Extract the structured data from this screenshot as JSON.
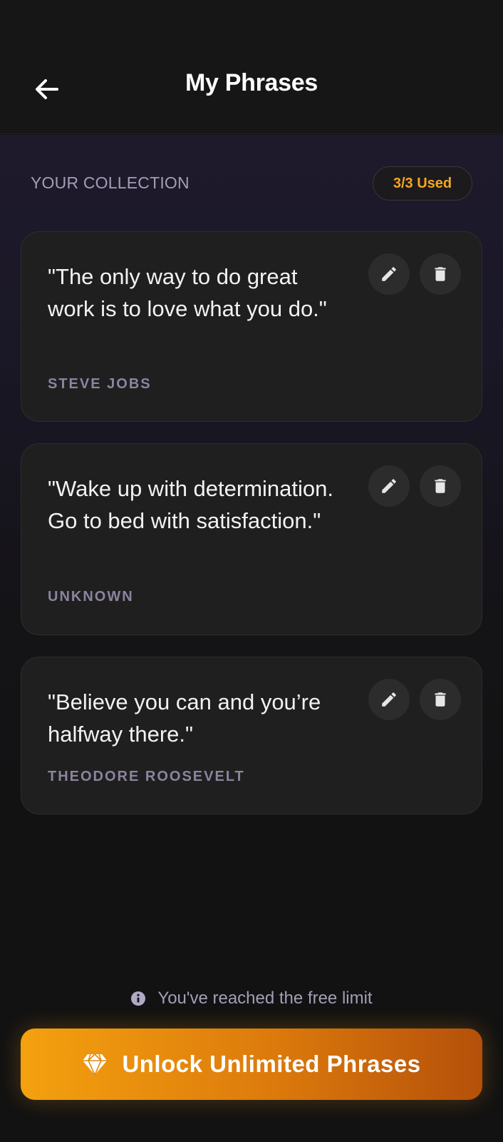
{
  "header": {
    "title": "My Phrases",
    "back_icon": "arrow-left-icon"
  },
  "collection": {
    "label": "YOUR COLLECTION",
    "usage_badge": "3/3 Used",
    "accent_color": "#f5a623"
  },
  "phrases": [
    {
      "quote": "\"The only way to do great work is to love what you do.\"",
      "author": "STEVE JOBS"
    },
    {
      "quote": "\"Wake up with determination. Go to bed with satisfaction.\"",
      "author": "UNKNOWN"
    },
    {
      "quote": "\"Believe you can and you’re halfway there.\"",
      "author": "THEODORE ROOSEVELT"
    }
  ],
  "footer": {
    "limit_note": "You've reached the free limit",
    "cta_label": "Unlock Unlimited Phrases",
    "cta_icon": "diamond-icon"
  }
}
